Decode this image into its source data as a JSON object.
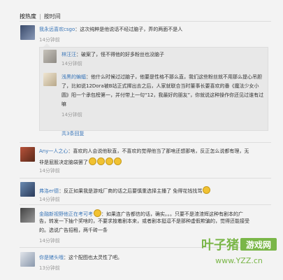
{
  "sort": {
    "hot": "按热度",
    "sep": "|",
    "time": "按时间"
  },
  "comments": [
    {
      "user": "我永远喜欢csgo",
      "text": "：这次纯粹是他说话不经过脑子，弄的两面不是人",
      "time": "14分钟前",
      "replies": [
        {
          "user": "林汪汪",
          "text": "：破案了，怪不得他的好多粉丝也没脑子",
          "time": "14分钟前"
        },
        {
          "user": "浅黑的蝙蝠",
          "lines": [
            "：他什么时候过过脑子，他要是性格不那么直，我们这些粉丝就不用那么提心吊胆",
            "了，比如说12Dora被B站正式撵出去之后，人家就联合当时董事长要喜欢的番《魔法少女小",
            "圆》阳一个承包榜第一，并付带上一句“12，我最好的朋友”，你就说这种操作你还见过谁有过",
            "嘛"
          ],
          "time": "14分钟前"
        }
      ],
      "more": "共3条回复"
    },
    {
      "user": "Any一人之心",
      "lines": [
        "：喜欢的人会说他耿直，不喜欢的觉得他当了那啥还想那啥，反正怎么说都有理，无",
        "非是屁股决定脑袋罢了"
      ],
      "time": "14分钟前"
    },
    {
      "user": "弗洛er德",
      "text": "：反正如果我是游戏厂商的话之后要慎重选择主播了 免得花钱找骂",
      "time": "14分钟前"
    },
    {
      "user": "金融新视野他正在考可考",
      "lines": [
        "：如果连广告都信的话，确实。。。只要不是渣渣辉这种有剧本的广",
        "告，转发一下抽个奖啥的，不要求按着剧本来，或者剧本挺逗不是那种虚假欺骗的，觉得还能接受",
        "的。选说广告招租，两千砖一条"
      ],
      "time": "14分钟前"
    },
    {
      "user": "你是猪头哦",
      "text": "：这个配图也太灵性了吧。",
      "time": "13分钟前"
    }
  ],
  "watermark": {
    "brand": "叶子猪",
    "sub": "游戏网",
    "url": "www.YZZ.cn"
  },
  "colors": {
    "link": "#3a76b8",
    "bg": "#f3f3f3",
    "reply_bg": "#e8e8e8"
  }
}
